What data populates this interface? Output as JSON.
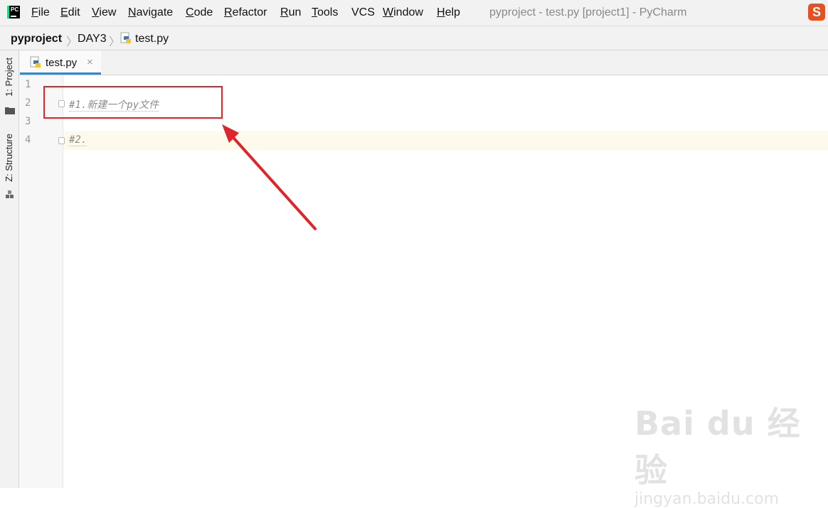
{
  "app": {
    "logo_text": "PC",
    "window_title": "pyproject - test.py [project1] - PyCharm",
    "ime_badge": "S"
  },
  "menu": [
    {
      "label": "File",
      "mnemonic": "F",
      "rest": "ile"
    },
    {
      "label": "Edit",
      "mnemonic": "E",
      "rest": "dit"
    },
    {
      "label": "View",
      "mnemonic": "V",
      "rest": "iew"
    },
    {
      "label": "Navigate",
      "mnemonic": "N",
      "rest": "avigate"
    },
    {
      "label": "Code",
      "mnemonic": "C",
      "rest": "ode"
    },
    {
      "label": "Refactor",
      "mnemonic": "R",
      "rest": "efactor"
    },
    {
      "label": "Run",
      "mnemonic": "R",
      "rest": "un"
    },
    {
      "label": "Tools",
      "mnemonic": "T",
      "rest": "ools"
    },
    {
      "label": "VCS",
      "mnemonic": "",
      "rest": "VCS"
    },
    {
      "label": "Window",
      "mnemonic": "W",
      "rest": "indow"
    },
    {
      "label": "Help",
      "mnemonic": "H",
      "rest": "elp"
    }
  ],
  "breadcrumb": [
    "pyproject",
    "DAY3",
    "test.py"
  ],
  "side_tabs": {
    "project": "1: Project",
    "structure": "Z: Structure"
  },
  "editor_tab": {
    "label": "test.py",
    "close": "×"
  },
  "lines": [
    {
      "number": "1",
      "text": ""
    },
    {
      "number": "2",
      "text": "#1.新建一个py文件"
    },
    {
      "number": "3",
      "text": ""
    },
    {
      "number": "4",
      "text": "#2."
    }
  ],
  "watermark": {
    "main": "Bai du 经验",
    "sub": "jingyan.baidu.com"
  },
  "colors": {
    "annotation_red": "#e0242a",
    "tab_underline": "#4083c9",
    "current_line": "#fdfaeb"
  }
}
